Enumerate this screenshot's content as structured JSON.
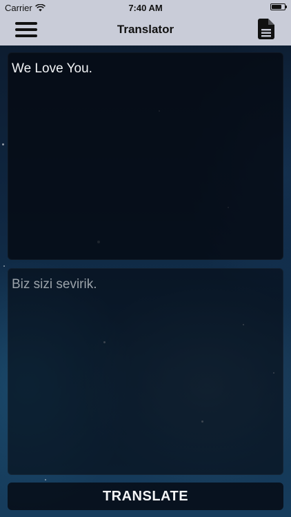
{
  "status_bar": {
    "carrier": "Carrier",
    "time": "7:40 AM"
  },
  "nav": {
    "title": "Translator",
    "left_icon": "hamburger-menu-icon",
    "right_icon": "document-icon"
  },
  "source_text": {
    "value": "We Love You."
  },
  "translated_text": {
    "value": "Biz sizi sevirik."
  },
  "translate_button": {
    "label": "TRANSLATE"
  },
  "colors": {
    "nav_background": "#c9ccd8",
    "panel_background": "#05101a",
    "source_text": "#f2f4f6",
    "translated_text": "#9ba3aa"
  }
}
